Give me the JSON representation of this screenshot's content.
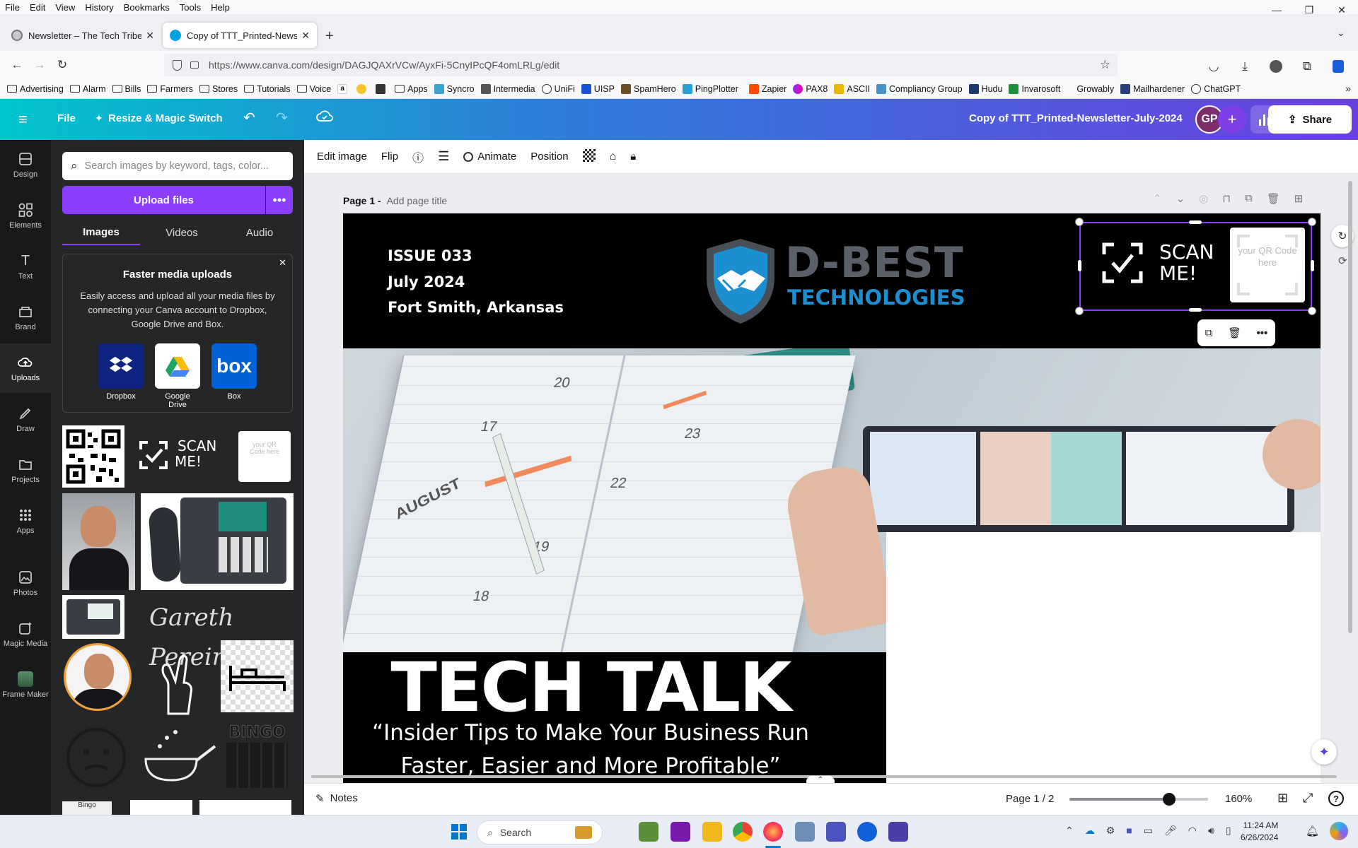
{
  "browser": {
    "menu": [
      "File",
      "Edit",
      "View",
      "History",
      "Bookmarks",
      "Tools",
      "Help"
    ],
    "tabs": [
      {
        "title": "Newsletter – The Tech Tribe",
        "close": "✕"
      },
      {
        "title": "Copy of TTT_Printed-Newsletter-",
        "close": "✕"
      }
    ],
    "new_tab": "+",
    "url": "https://www.canva.com/design/DAGJQAXrVCw/AyxFi-5CnyIPcQF4omLRLg/edit",
    "bookmarks": [
      "Advertising",
      "Alarm",
      "Bills",
      "Farmers",
      "Stores",
      "Tutorials",
      "Voice",
      "Apps",
      "Syncro",
      "Intermedia",
      "UniFi",
      "UISP",
      "SpamHero",
      "PingPlotter",
      "Zapier",
      "PAX8",
      "ASCII",
      "Compliancy Group",
      "Hudu",
      "Invarosoft",
      "Growably",
      "Mailhardener",
      "ChatGPT"
    ]
  },
  "canva_header": {
    "file": "File",
    "resize": "Resize & Magic Switch",
    "doc_title": "Copy of  TTT_Printed-Newsletter-July-2024",
    "avatar": "GP",
    "share": "Share"
  },
  "rail": [
    "Design",
    "Elements",
    "Text",
    "Brand",
    "Uploads",
    "Draw",
    "Projects",
    "Apps",
    "Photos",
    "Magic Media",
    "Frame Maker"
  ],
  "panel": {
    "search_placeholder": "Search images by keyword, tags, color...",
    "upload": "Upload files",
    "tabs": [
      "Images",
      "Videos",
      "Audio"
    ],
    "promo_title": "Faster media uploads",
    "promo_text": "Easily access and upload all your media files by connecting your Canva account to Dropbox, Google Drive and Box.",
    "services": [
      "Dropbox",
      "Google Drive",
      "Box"
    ],
    "signature": "Gareth Pereira",
    "bingo": "BINGO",
    "bingo_small": "Bingo",
    "bed_label": "",
    "thumb_scan": {
      "line1": "SCAN",
      "line2": "ME!"
    },
    "thumb_qr": "your QR Code here"
  },
  "toolbar": {
    "edit_image": "Edit image",
    "flip": "Flip",
    "animate": "Animate",
    "position": "Position"
  },
  "page": {
    "label": "Page 1 -",
    "title_placeholder": "Add page title",
    "issue": "ISSUE 033",
    "date": "July 2024",
    "location": "Fort Smith, Arkansas",
    "logo_main": "D-BEST",
    "logo_sub": "TECHNOLOGIES",
    "scan_line1": "SCAN",
    "scan_line2": "ME!",
    "qr_placeholder": "your QR Code here",
    "headline": "TECH TALK",
    "tagline1": "“Insider Tips to Make Your Business Run",
    "tagline2": "Faster, Easier and More Profitable”",
    "calendar_month": "AUGUST",
    "calendar_days": [
      "17",
      "20",
      "22",
      "23",
      "19",
      "18"
    ]
  },
  "footer": {
    "notes": "Notes",
    "page_indicator": "Page 1 / 2",
    "zoom": "160%",
    "zoom_level": 0.72
  },
  "taskbar": {
    "search": "Search",
    "time": "11:24 AM",
    "date": "6/26/2024"
  }
}
